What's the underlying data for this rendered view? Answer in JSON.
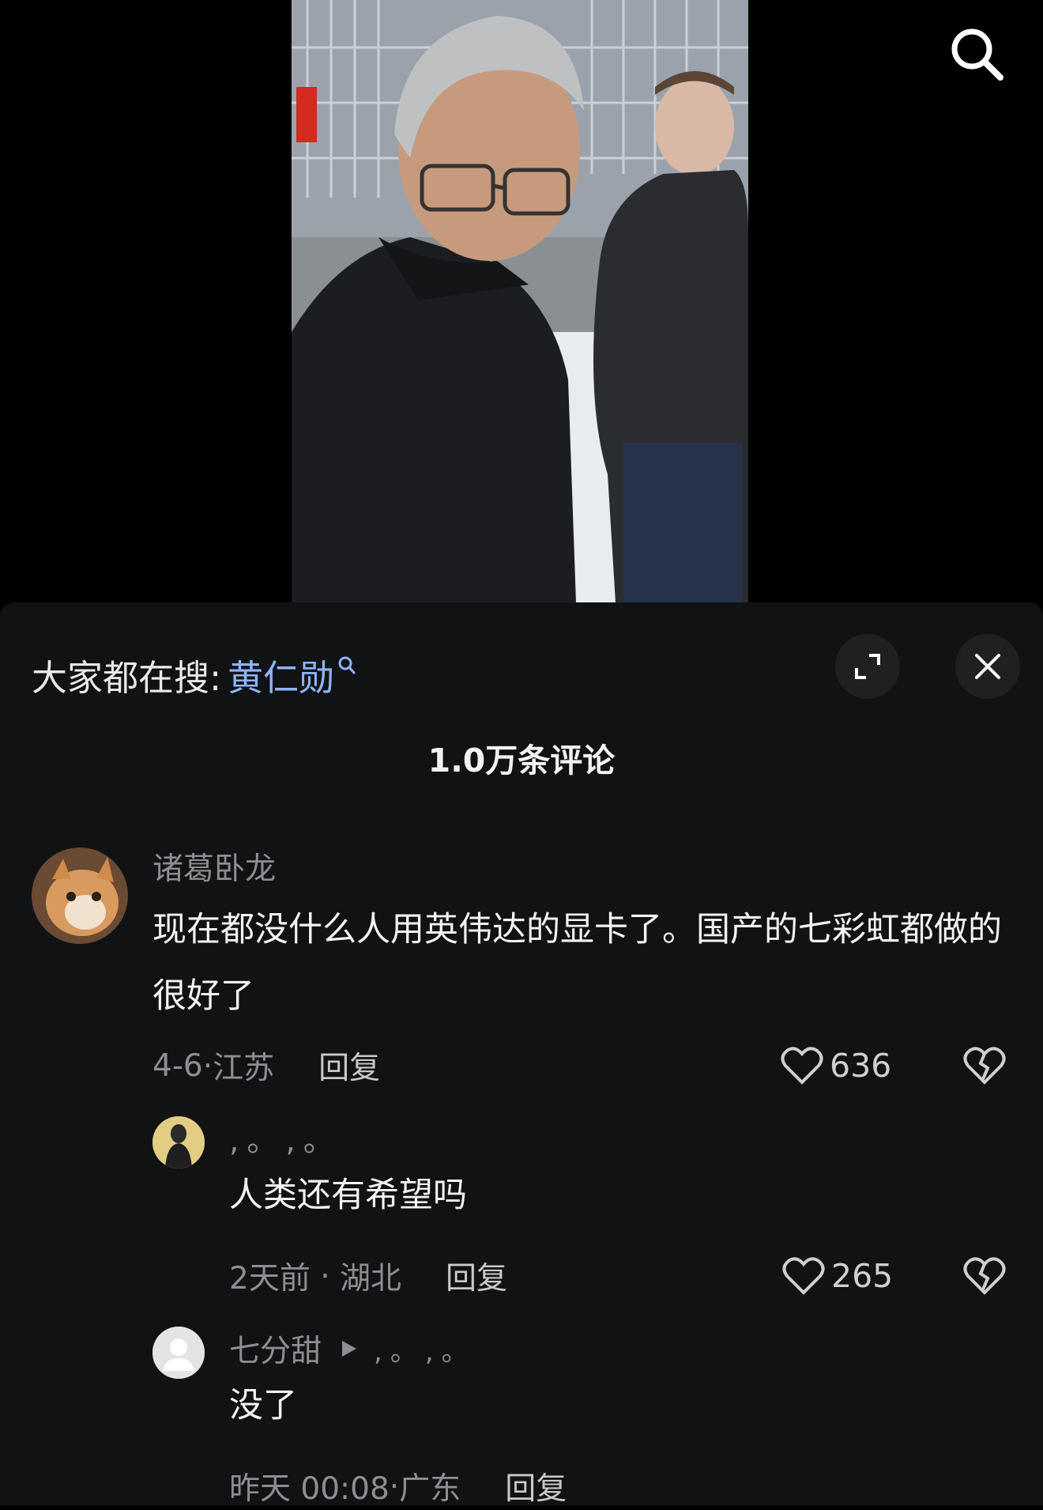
{
  "video": {
    "search_icon": "search-icon"
  },
  "sheet": {
    "trending_prefix": "大家都在搜:",
    "trending_term": "黄仁勋",
    "expand_icon": "expand-icon",
    "close_icon": "close-icon",
    "comment_count": "1.0万条评论"
  },
  "comments": [
    {
      "username": "诸葛卧龙",
      "text": "现在都没什么人用英伟达的显卡了。国产的七彩虹都做的很好了",
      "date": "4-6",
      "location": "江苏",
      "reply": "回复",
      "likes": "636"
    },
    {
      "username": ",。,。",
      "text": "人类还有希望吗",
      "date": "2天前",
      "location": "湖北",
      "reply": "回复",
      "likes": "265"
    },
    {
      "username": "七分甜",
      "reply_to": ",。,。",
      "text": "没了",
      "date": "昨天 00:08",
      "location": "广东",
      "reply": "回复"
    }
  ],
  "colors": {
    "accent_link": "#8fb4ff",
    "sheet_bg": "#111213",
    "muted_text": "#8d8e91"
  }
}
